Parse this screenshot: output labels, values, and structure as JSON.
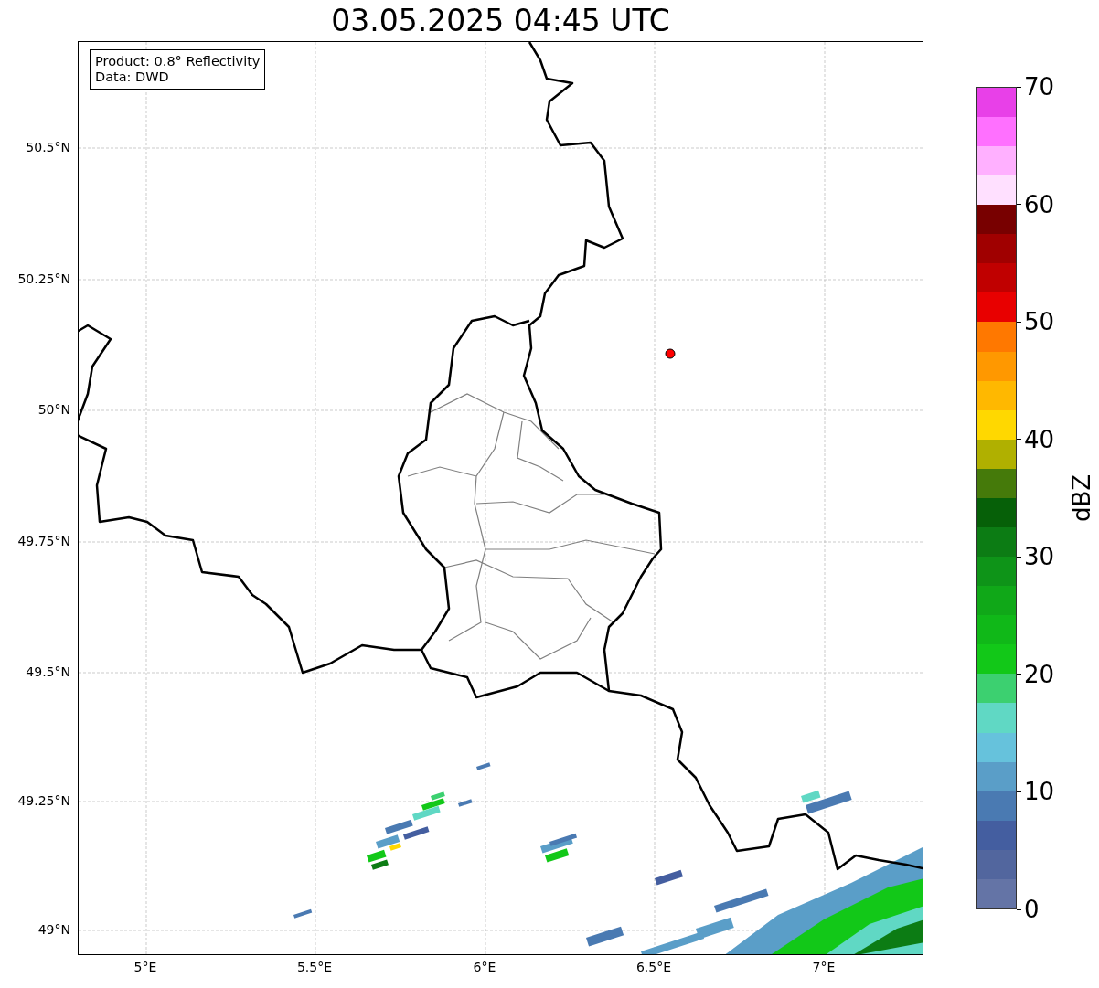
{
  "title": "03.05.2025 04:45 UTC",
  "legend": {
    "lines": [
      "Product: 0.8° Reflectivity",
      "Data: DWD"
    ]
  },
  "map": {
    "lat_labels": [
      "50.5°N",
      "50.25°N",
      "50°N",
      "49.75°N",
      "49.5°N",
      "49.25°N",
      "49°N"
    ],
    "lon_labels": [
      "5°E",
      "5.5°E",
      "6°E",
      "6.5°E",
      "7°E"
    ]
  },
  "colorbar": {
    "label": "dBZ",
    "ticks": [
      "70",
      "60",
      "50",
      "40",
      "30",
      "20",
      "10",
      "0"
    ],
    "segments": [
      {
        "color": "#6474a6"
      },
      {
        "color": "#52669e"
      },
      {
        "color": "#445ea0"
      },
      {
        "color": "#4a7ab2"
      },
      {
        "color": "#5a9ec8"
      },
      {
        "color": "#66c2dc"
      },
      {
        "color": "#60d8c4"
      },
      {
        "color": "#3cd070"
      },
      {
        "color": "#12c818"
      },
      {
        "color": "#10b818"
      },
      {
        "color": "#10a818"
      },
      {
        "color": "#0e9418"
      },
      {
        "color": "#0c7c14"
      },
      {
        "color": "#066008"
      },
      {
        "color": "#457a0a"
      },
      {
        "color": "#b0b000"
      },
      {
        "color": "#ffd800"
      },
      {
        "color": "#ffb800"
      },
      {
        "color": "#ff9800"
      },
      {
        "color": "#ff7800"
      },
      {
        "color": "#e80000"
      },
      {
        "color": "#c00000"
      },
      {
        "color": "#a00000"
      },
      {
        "color": "#780000"
      },
      {
        "color": "#ffe0ff"
      },
      {
        "color": "#ffb0ff"
      },
      {
        "color": "#ff70ff"
      },
      {
        "color": "#e840e8"
      }
    ]
  }
}
